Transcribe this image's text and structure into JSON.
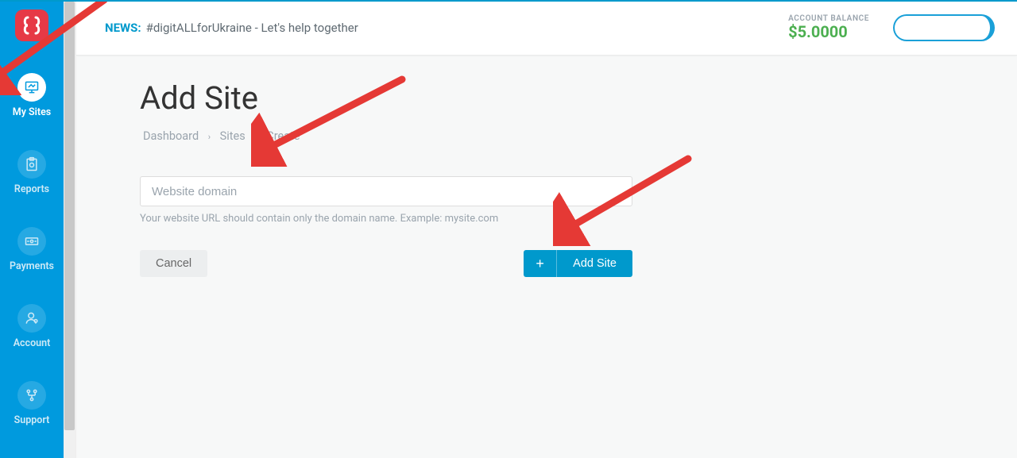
{
  "sidebar": {
    "items": [
      {
        "label": "My Sites"
      },
      {
        "label": "Reports"
      },
      {
        "label": "Payments"
      },
      {
        "label": "Account"
      },
      {
        "label": "Support"
      }
    ]
  },
  "topbar": {
    "news_prefix": "NEWS:",
    "news_text": "#digitALLforUkraine - Let's help together",
    "balance_label": "ACCOUNT BALANCE",
    "balance_value": "$5.0000"
  },
  "page": {
    "title": "Add Site",
    "breadcrumb": {
      "a": "Dashboard",
      "b": "Sites",
      "c": "Create"
    },
    "domain_placeholder": "Website domain",
    "helper_text": "Your website URL should contain only the domain name. Example: mysite.com",
    "cancel_label": "Cancel",
    "add_label": "Add Site"
  }
}
